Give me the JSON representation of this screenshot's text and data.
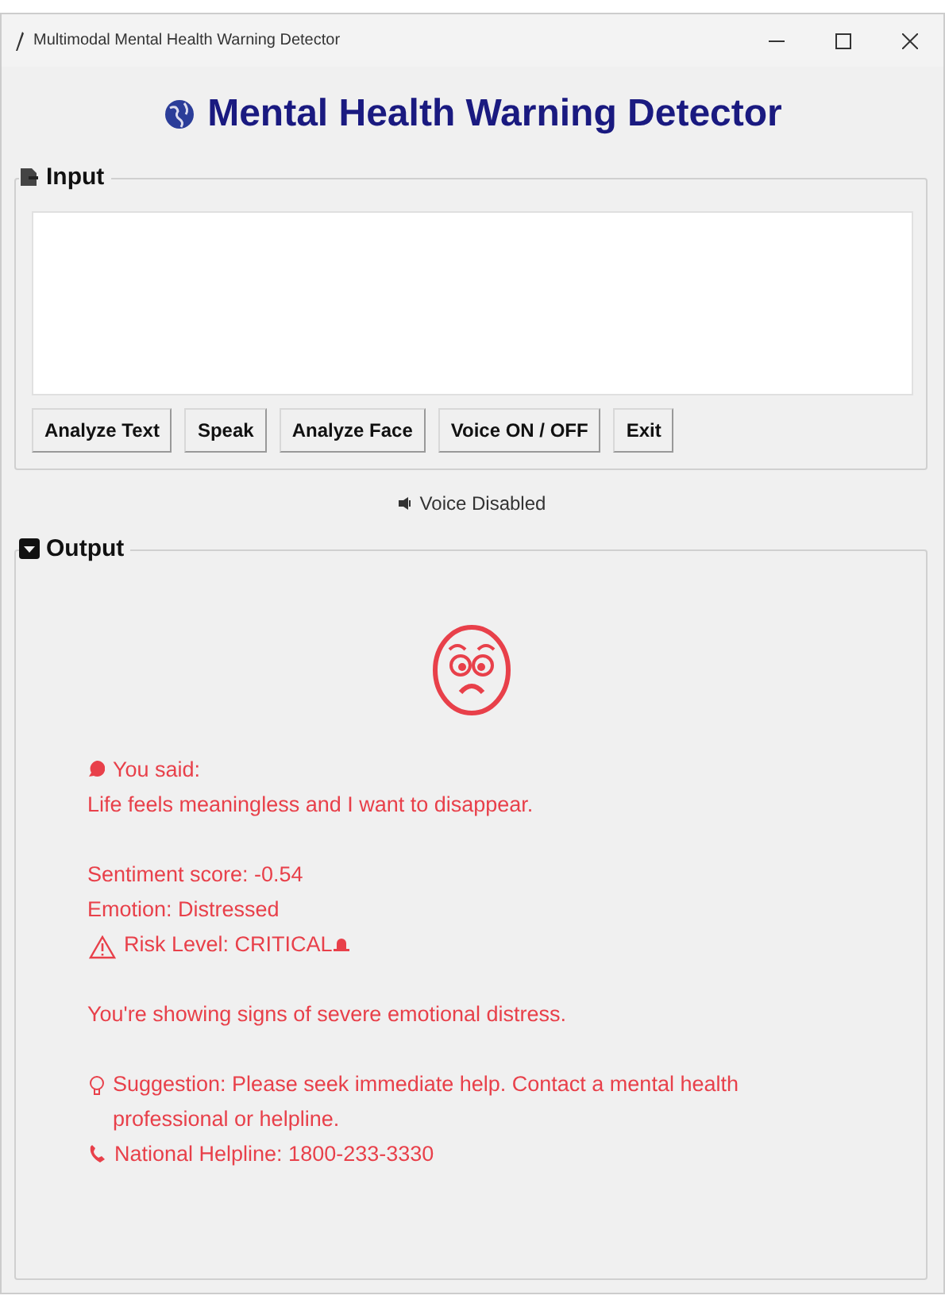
{
  "window": {
    "title": "Multimodal Mental Health Warning Detector"
  },
  "heading": "Mental Health Warning Detector",
  "input": {
    "label": "Input",
    "buttons": [
      "Analyze Text",
      "Speak",
      "Analyze Face",
      "Voice ON / OFF",
      "Exit"
    ]
  },
  "voice_status": "Voice Disabled",
  "output": {
    "label": "Output",
    "paragraphs": [
      {
        "lines": [
          {
            "kind": "said",
            "text": "You said:"
          },
          {
            "kind": "plain",
            "text": "Life feels meaningless and I want to disappear."
          }
        ]
      },
      {
        "lines": [
          {
            "kind": "plain",
            "text": "Sentiment score: -0.54"
          },
          {
            "kind": "plain",
            "text": "Emotion: Distressed"
          },
          {
            "kind": "risk",
            "text": "Risk Level: CRITICAL"
          }
        ]
      },
      {
        "lines": [
          {
            "kind": "plain",
            "text": "You're showing signs of severe emotional distress."
          }
        ]
      },
      {
        "lines": [
          {
            "kind": "suggestion",
            "text": "Suggestion: Please seek immediate help. Contact a mental health professional or helpline."
          },
          {
            "kind": "helpline",
            "text": "National Helpline: 1800-233-3330"
          }
        ]
      }
    ]
  }
}
